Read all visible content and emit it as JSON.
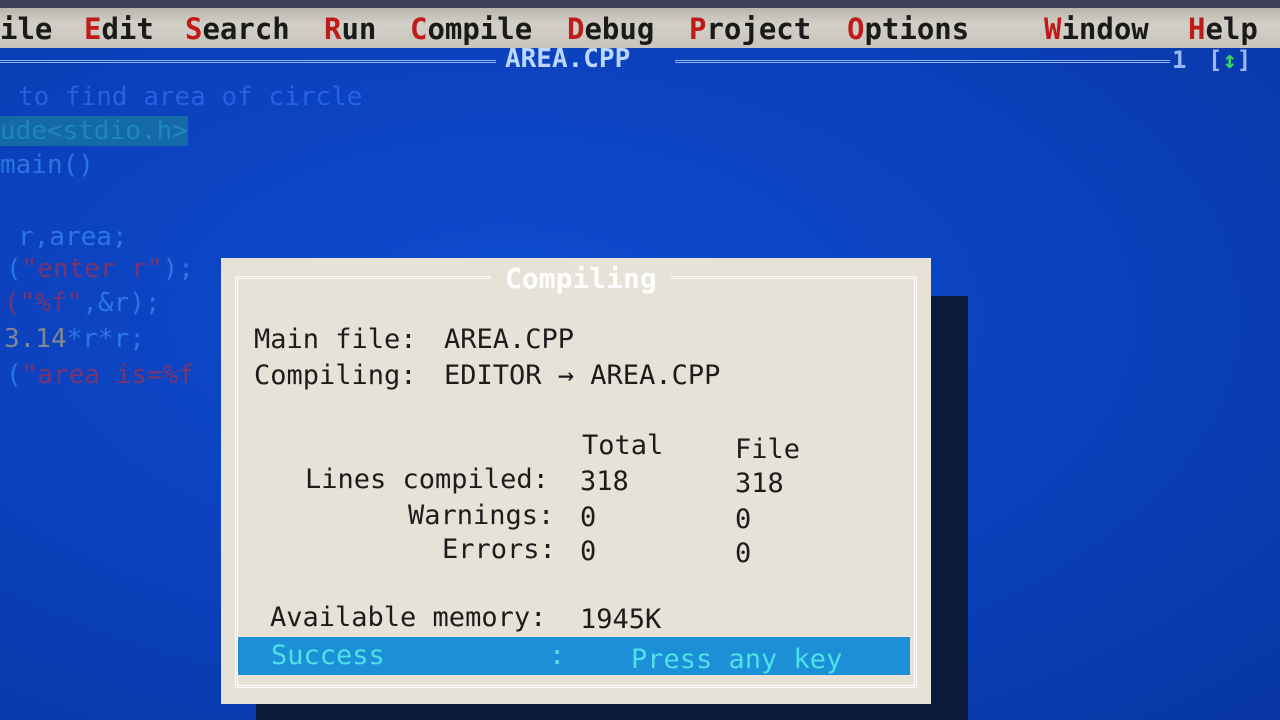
{
  "menu": {
    "items": [
      {
        "hot": "",
        "rest": "ile"
      },
      {
        "hot": "E",
        "rest": "dit"
      },
      {
        "hot": "S",
        "rest": "earch"
      },
      {
        "hot": "R",
        "rest": "un"
      },
      {
        "hot": "C",
        "rest": "ompile"
      },
      {
        "hot": "D",
        "rest": "ebug"
      },
      {
        "hot": "P",
        "rest": "roject"
      },
      {
        "hot": "O",
        "rest": "ptions"
      },
      {
        "hot": "W",
        "rest": "indow"
      },
      {
        "hot": "H",
        "rest": "elp"
      }
    ]
  },
  "editor": {
    "file_title": "AREA.CPP",
    "window_number": "1",
    "window_control_open": "[",
    "window_control_glyph": "↕",
    "window_control_close": "]",
    "code": {
      "line1": "to find area of circle",
      "line2": "ude<stdio.h>",
      "line3": "main()",
      "line4": "r,area;",
      "line5_fn": "(",
      "line5_str": "\"enter r\"",
      "line5_end": ");",
      "line6_str": "(\"%f\"",
      "line6_end": ",&r);",
      "line7_num": "3.14",
      "line7_rest": "*r*r;",
      "line8_fn": "(",
      "line8_str": "\"area is=%f"
    }
  },
  "dialog": {
    "title": "Compiling",
    "main_file_label": "Main file:",
    "main_file_value": "AREA.CPP",
    "compiling_label": "Compiling:",
    "compiling_value": "EDITOR → AREA.CPP",
    "col_total": "Total",
    "col_file": "File",
    "rows": [
      {
        "label": "Lines compiled:",
        "total": "318",
        "file": "318"
      },
      {
        "label": "Warnings:",
        "total": "0",
        "file": "0"
      },
      {
        "label": "Errors:",
        "total": "0",
        "file": "0"
      }
    ],
    "memory_label": "Available memory:",
    "memory_value": "1945K",
    "status": {
      "result": "Success",
      "separator": ":",
      "prompt": "Press any key"
    }
  }
}
